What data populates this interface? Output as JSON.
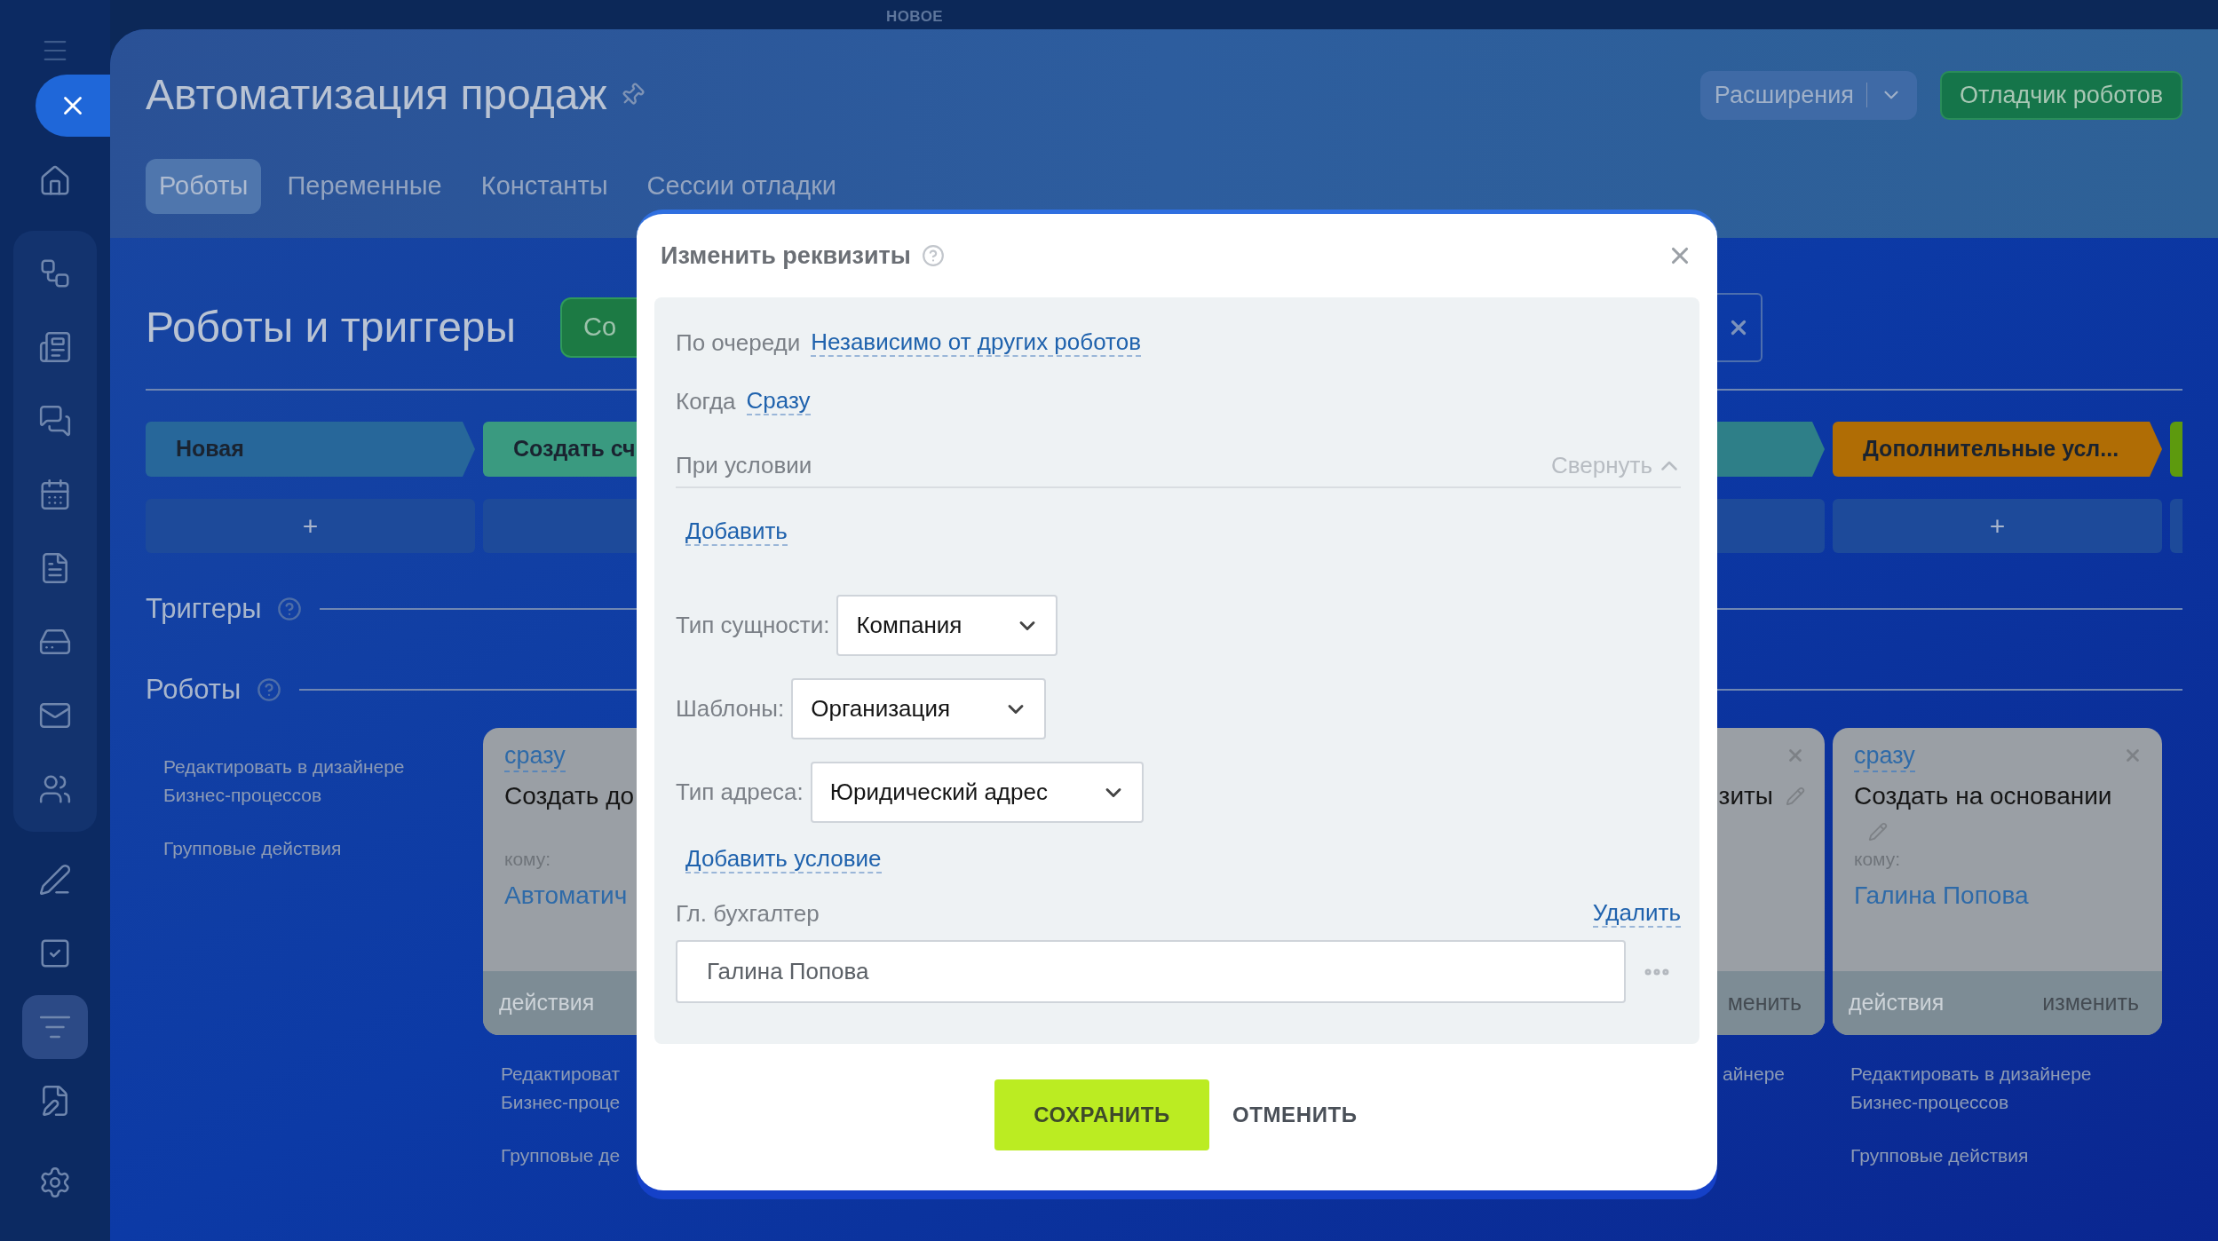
{
  "sidebar": {
    "sections": [
      [
        {
          "kind": "home",
          "selected": false
        }
      ],
      [
        {
          "kind": "workflow",
          "selected": false
        },
        {
          "kind": "news",
          "selected": false
        },
        {
          "kind": "chat",
          "selected": false
        },
        {
          "kind": "calendar",
          "selected": false
        },
        {
          "kind": "file",
          "selected": false
        },
        {
          "kind": "drive",
          "selected": false
        },
        {
          "kind": "mail",
          "selected": false
        },
        {
          "kind": "users",
          "selected": false
        }
      ],
      [
        {
          "kind": "pen",
          "selected": false
        },
        {
          "kind": "check",
          "selected": false
        },
        {
          "kind": "funnel",
          "selected": true
        },
        {
          "kind": "file-pen",
          "selected": false
        }
      ],
      [
        {
          "kind": "settings",
          "selected": false
        }
      ]
    ]
  },
  "top_label": "НОВОЕ",
  "header": {
    "title": "Автоматизация продаж",
    "tabs": [
      {
        "label": "Роботы",
        "selected": true
      },
      {
        "label": "Переменные",
        "selected": false
      },
      {
        "label": "Константы",
        "selected": false
      },
      {
        "label": "Сессии отладки",
        "selected": false
      }
    ],
    "extensions_button": "Расширения",
    "debugger_button": "Отладчик роботов"
  },
  "section": {
    "title": "Роботы и триггеры",
    "create_button": "Со"
  },
  "stages": [
    {
      "label": "Новая",
      "color": "#27679a",
      "add": "+"
    },
    {
      "label": "Создать сч",
      "color": "#3a9a80"
    },
    {
      "color": "#2e7f88"
    },
    {
      "label": "Дополнительные усл...",
      "color": "#b06d05",
      "add": "+"
    },
    {
      "color": "#5d9a0e"
    }
  ],
  "triggers": {
    "title": "Триггеры"
  },
  "robots": {
    "title": "Роботы",
    "designer_link": [
      "Редактировать в дизайнере",
      "Бизнес-процессов"
    ],
    "group_link": "Групповые действия",
    "cards": [
      {
        "kind": "left_part",
        "when": "сразу",
        "name": "Создать до",
        "to_label": "кому:",
        "to": "Автоматич",
        "footer_left": "действия",
        "designer_link": [
          "Редактироват",
          "Бизнес-проце"
        ],
        "group_link": "Групповые де"
      },
      {
        "kind": "right_part",
        "name": "зиты",
        "footer_right": "менить",
        "designer_link": [
          "айнере"
        ]
      },
      {
        "kind": "full",
        "when": "сразу",
        "name": "Создать на основании",
        "to_label": "кому:",
        "to": "Галина Попова",
        "footer_left": "действия",
        "footer_right": "изменить",
        "designer_link": [
          "Редактировать в дизайнере",
          "Бизнес-процессов"
        ],
        "group_link": "Групповые действия"
      }
    ]
  },
  "modal": {
    "title": "Изменить реквизиты",
    "queue_label": "По очереди",
    "queue_value": "Независимо от других роботов",
    "when_label": "Когда",
    "when_value": "Сразу",
    "condition_label": "При условии",
    "collapse": "Свернуть",
    "add_link": "Добавить",
    "selects": [
      {
        "label": "Тип сущности:",
        "value": "Компания"
      },
      {
        "label": "Шаблоны:",
        "value": "Организация"
      },
      {
        "label": "Тип адреса:",
        "value": "Юридический адрес"
      }
    ],
    "add_condition": "Добавить условие",
    "field_label": "Гл. бухгалтер",
    "delete_link": "Удалить",
    "field_value": "Галина Попова",
    "save": "СОХРАНИТЬ",
    "cancel": "ОТМЕНИТЬ"
  }
}
